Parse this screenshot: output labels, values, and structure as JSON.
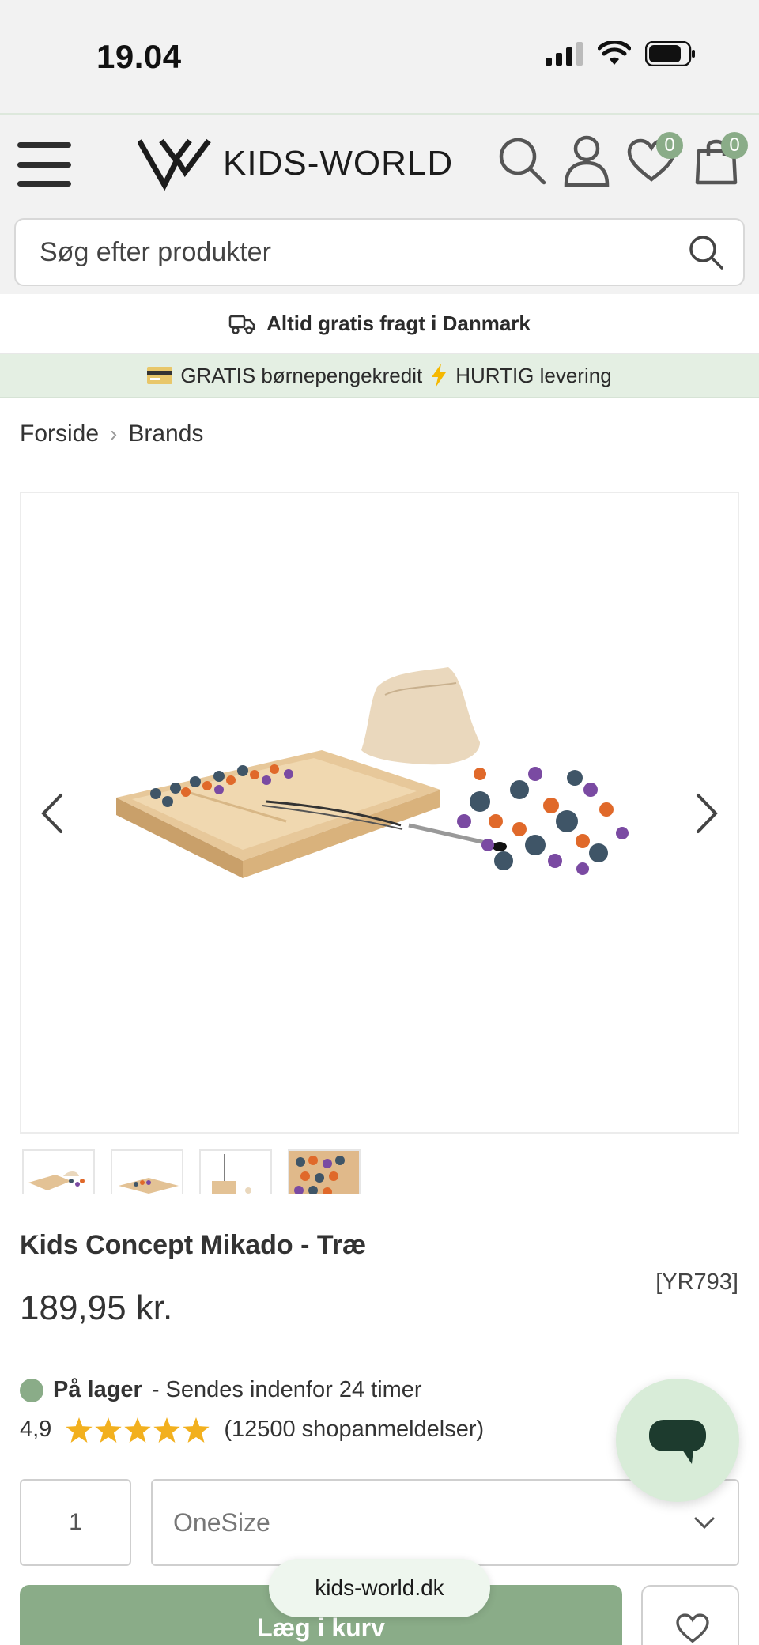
{
  "status_bar": {
    "time": "19.04"
  },
  "header": {
    "brand": "KIDS-WORLD",
    "wishlist_count": "0",
    "cart_count": "0"
  },
  "search": {
    "placeholder": "Søg efter produkter"
  },
  "shipping": {
    "text": "Altid gratis fragt i Danmark"
  },
  "promo": {
    "text": "GRATIS børnepengekredit",
    "text2": "HURTIG levering"
  },
  "breadcrumb": {
    "home": "Forside",
    "current": "Brands"
  },
  "product": {
    "title": "Kids Concept Mikado - Træ",
    "sku": "[YR793]",
    "price": "189,95 kr.",
    "stock_label": "På lager",
    "stock_note": "- Sendes indenfor 24 timer",
    "rating": "4,9",
    "reviews": "(12500 shopanmeldelser)",
    "quantity": "1",
    "size": "OneSize",
    "add_to_cart": "Læg i kurv"
  },
  "browser": {
    "url": "kids-world.dk"
  },
  "colors": {
    "accent": "#8aac88",
    "promo_bg": "#e4efe3",
    "star": "#f2b01e"
  }
}
